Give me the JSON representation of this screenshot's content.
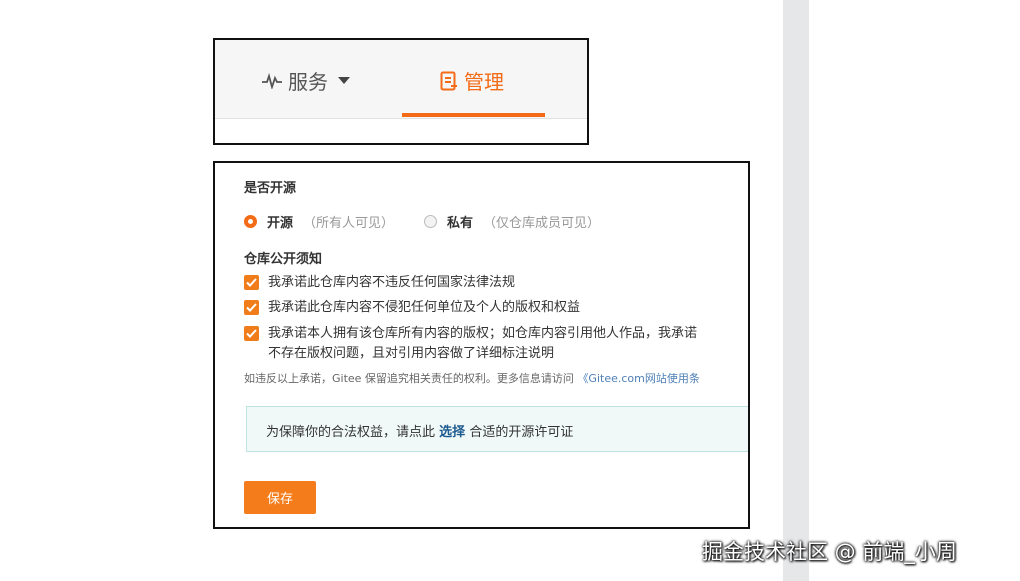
{
  "tabs": {
    "service": {
      "label": "服务",
      "icon": "pulse-icon"
    },
    "manage": {
      "label": "管理",
      "icon": "document-icon"
    },
    "active_color": "#f46b17"
  },
  "form": {
    "open_source_title": "是否开源",
    "options": [
      {
        "label": "开源",
        "hint": "（所有人可见）",
        "selected": true
      },
      {
        "label": "私有",
        "hint": "（仅仓库成员可见）",
        "selected": false
      }
    ],
    "notice_title": "仓库公开须知",
    "promises": [
      {
        "text": "我承诺此仓库内容不违反任何国家法律法规",
        "checked": true
      },
      {
        "text": "我承诺此仓库内容不侵犯任何单位及个人的版权和权益",
        "checked": true
      },
      {
        "line1": "我承诺本人拥有该仓库所有内容的版权；如仓库内容引用他人作品，我承诺",
        "line2": "不存在版权问题，且对引用内容做了详细标注说明",
        "checked": true
      }
    ],
    "note_text": "如违反以上承诺，Gitee 保留追究相关责任的权利。更多信息请访问",
    "note_link": "《Gitee.com网站使用条",
    "license_prefix": "为保障你的合法权益，请点此",
    "license_link": "选择",
    "license_suffix": "合适的开源许可证",
    "save_label": "保存"
  },
  "watermark": "掘金技术社区 @ 前端_小周",
  "colors": {
    "accent": "#f57c1a",
    "link": "#4e7fb6",
    "license_bg": "#f0f9f8"
  }
}
